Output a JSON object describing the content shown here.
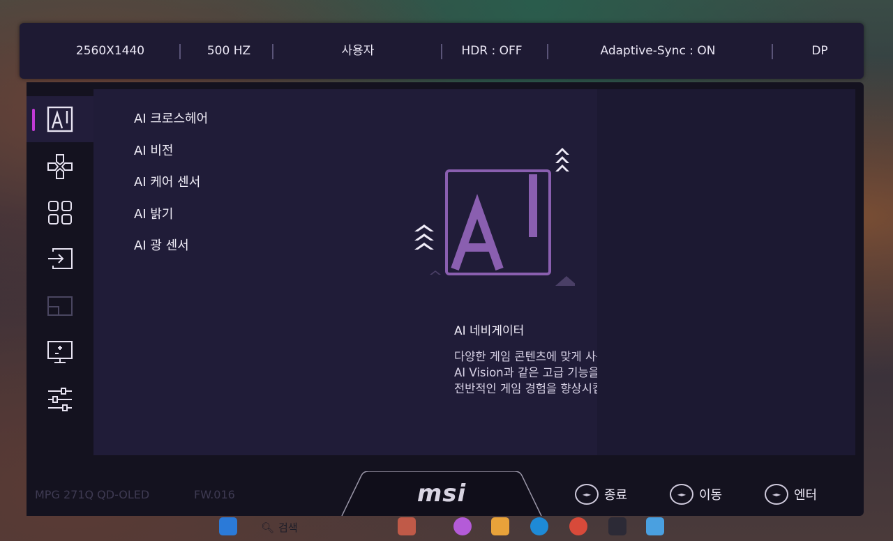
{
  "topbar": {
    "resolution": "2560X1440",
    "refresh": "500 HZ",
    "mode": "사용자",
    "hdr": "HDR : OFF",
    "adaptive_sync": "Adaptive-Sync : ON",
    "input": "DP"
  },
  "sidebar": {
    "items": [
      {
        "icon": "ai-icon",
        "active": true
      },
      {
        "icon": "gamepad-icon",
        "active": false
      },
      {
        "icon": "grid-icon",
        "active": false
      },
      {
        "icon": "input-source-icon",
        "active": false
      },
      {
        "icon": "pip-icon",
        "active": false
      },
      {
        "icon": "display-icon",
        "active": false
      },
      {
        "icon": "sliders-icon",
        "active": false
      }
    ]
  },
  "menu": {
    "items": [
      {
        "label": "AI 크로스헤어"
      },
      {
        "label": "AI 비전"
      },
      {
        "label": "AI 케어 센서"
      },
      {
        "label": "AI 밝기"
      },
      {
        "label": "AI 광 센서"
      }
    ]
  },
  "description": {
    "title": "AI 네비게이터",
    "lines": [
      "다양한 게임 콘텐츠에 맞게 사용자 지정할 수 있는",
      "AI Vision과 같은 고급 기능을 제공하여,",
      "전반적인 게임 경험을 향상시킵니다."
    ]
  },
  "footer": {
    "model": "MPG 271Q QD-OLED",
    "firmware": "FW.016",
    "brand": "msi",
    "buttons": [
      {
        "label": "종료",
        "icon": "joystick-exit-icon"
      },
      {
        "label": "이동",
        "icon": "joystick-move-icon"
      },
      {
        "label": "엔터",
        "icon": "joystick-enter-icon"
      }
    ]
  },
  "taskbar": {
    "search_label": "검색"
  },
  "colors": {
    "accent": "#c23ad6",
    "illustration": "#8a5fb0",
    "panel_bg": "#201c38",
    "topbar_bg": "#1e1a33"
  }
}
